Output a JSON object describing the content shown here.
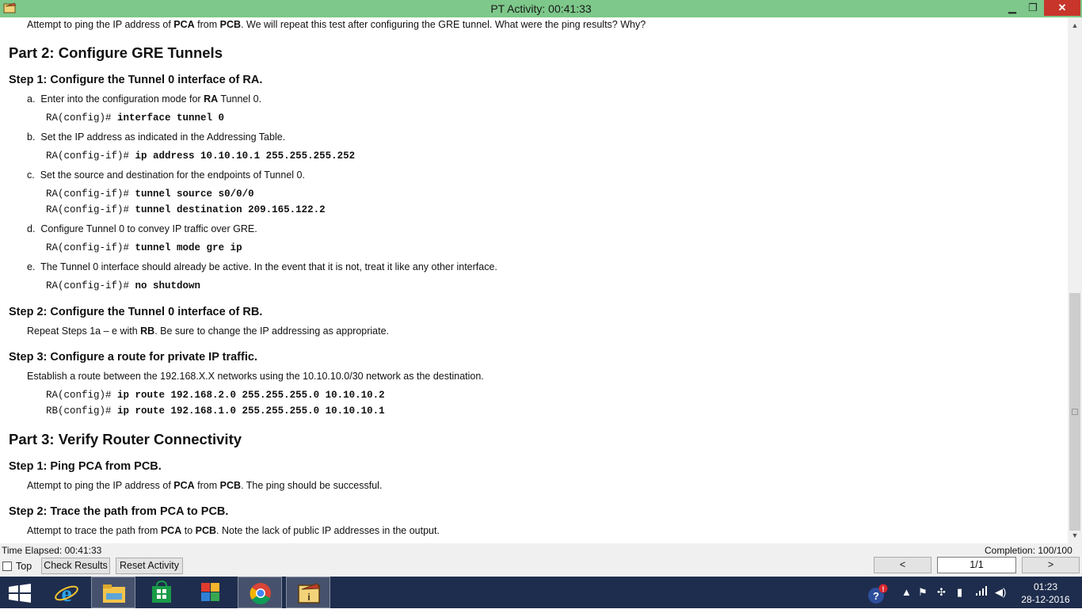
{
  "window": {
    "title": "PT Activity: 00:41:33"
  },
  "doc": {
    "intro": "Attempt to ping the IP address of PCA from PCB. We will repeat this test after configuring the GRE tunnel. What were the ping results? Why?",
    "part2_title": "Part 2:  Configure GRE Tunnels",
    "step1_title": "Step 1:  Configure the Tunnel 0 interface of RA.",
    "a": {
      "label": "a.",
      "pre": "Enter into the configuration mode for ",
      "bold": "RA",
      "post": " Tunnel 0."
    },
    "a_prompt": "RA(config)#",
    "a_cmd": "interface tunnel 0",
    "b": {
      "label": "b.",
      "text": "Set the IP address as indicated in the Addressing Table."
    },
    "b_prompt": "RA(config-if)#",
    "b_cmd": "ip address 10.10.10.1 255.255.255.252",
    "c": {
      "label": "c.",
      "text": "Set the source and destination for the endpoints of Tunnel 0."
    },
    "c_prompt1": "RA(config-if)#",
    "c_cmd1": "tunnel source s0/0/0",
    "c_prompt2": "RA(config-if)#",
    "c_cmd2": "tunnel destination 209.165.122.2",
    "d": {
      "label": "d.",
      "text": "Configure Tunnel 0 to convey IP traffic over GRE."
    },
    "d_prompt": "RA(config-if)#",
    "d_cmd": "tunnel mode gre ip",
    "e": {
      "label": "e.",
      "text": "The Tunnel 0 interface should already be active. In the event that it is not, treat it like any other interface."
    },
    "e_prompt": "RA(config-if)#",
    "e_cmd": "no shutdown",
    "step2_title": "Step 2:  Configure the Tunnel 0 interface of RB.",
    "step2": {
      "pre": "Repeat Steps 1a – e with ",
      "bold": "RB",
      "post": ". Be sure to change the IP addressing as appropriate."
    },
    "step3_title": "Step 3:  Configure a route for private IP traffic.",
    "step3_text": "Establish a route between the 192.168.X.X networks using the 10.10.10.0/30 network as the destination.",
    "r1_prompt": "RA(config)#",
    "r1_cmd": "ip route 192.168.2.0 255.255.255.0 10.10.10.2",
    "r2_prompt": "RB(config)#",
    "r2_cmd": "ip route 192.168.1.0 255.255.255.0 10.10.10.1",
    "part3_title": "Part 3:  Verify Router Connectivity",
    "p3s1_title": "Step 1:  Ping PCA from PCB.",
    "p3s1": {
      "pre": "Attempt to ping the IP address of ",
      "b1": "PCA",
      "mid": " from ",
      "b2": "PCB",
      "post": ". The ping should be successful."
    },
    "p3s2_title": "Step 2:  Trace the path from PCA to PCB.",
    "p3s2": {
      "pre": "Attempt to trace the path from ",
      "b1": "PCA",
      "mid": " to ",
      "b2": "PCB",
      "post": ". Note the lack of public IP addresses in the output."
    }
  },
  "intro_parts": {
    "pre": "Attempt to ping the IP address of ",
    "b1": "PCA",
    "mid": " from ",
    "b2": "PCB",
    "post": ". We will repeat this test after configuring the GRE tunnel. What were the ping results? Why?"
  },
  "status": {
    "time_elapsed": "Time Elapsed: 00:41:33",
    "completion": "Completion: 100/100",
    "top_label": "Top",
    "check_results": "Check Results",
    "reset_activity": "Reset Activity",
    "prev": "<",
    "page": "1/1",
    "next": ">"
  },
  "taskbar": {
    "icons": [
      "windows-start-icon",
      "internet-explorer-icon",
      "file-explorer-icon",
      "store-icon",
      "puzzle-app-icon",
      "chrome-icon",
      "packet-tracer-icon"
    ],
    "time": "01:23",
    "date": "28-12-2016"
  },
  "colors": {
    "titlebar": "#7dc88a",
    "close": "#c7352b",
    "taskbar": "#1e2d4d"
  }
}
